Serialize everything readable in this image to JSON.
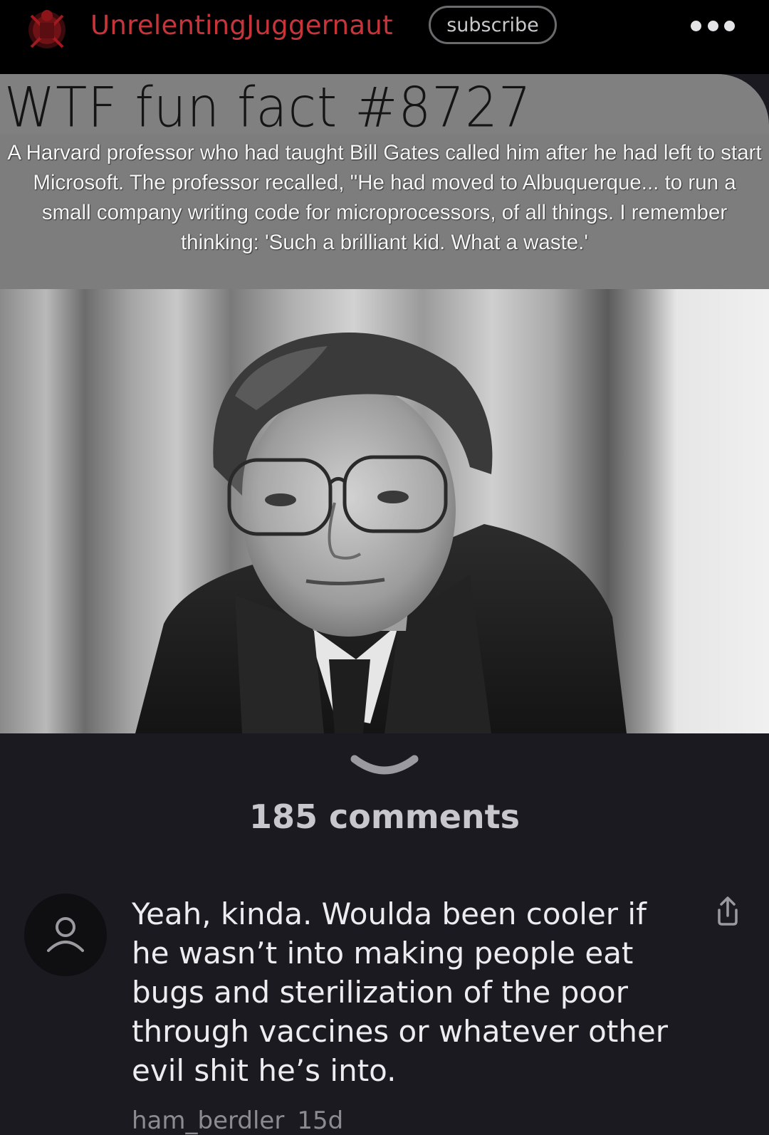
{
  "header": {
    "username": "UnrelentingJuggernaut",
    "subscribe_label": "subscribe",
    "more_icon": "more-horizontal-icon",
    "brand_color": "#c7343a"
  },
  "post": {
    "title": "WTF fun fact #8727",
    "fact_text": "A Harvard professor who had taught Bill Gates called him after he had left to start Microsoft. The professor recalled, \"He had moved to Albuquerque... to run a small company writing code for microprocessors, of all things. I remember thinking: 'Such a brilliant kid. What a waste.'"
  },
  "comments_section": {
    "expand_icon": "chevron-down-icon",
    "count_label": "185 comments"
  },
  "comment": {
    "text": "Yeah, kinda. Woulda been cooler if he wasn’t into making people eat bugs and sterilization of the poor through vaccines or whatever other evil shit he’s into.",
    "author": "ham_berdler",
    "age": "15d",
    "avatar_icon": "user-icon",
    "share_icon": "share-icon"
  }
}
